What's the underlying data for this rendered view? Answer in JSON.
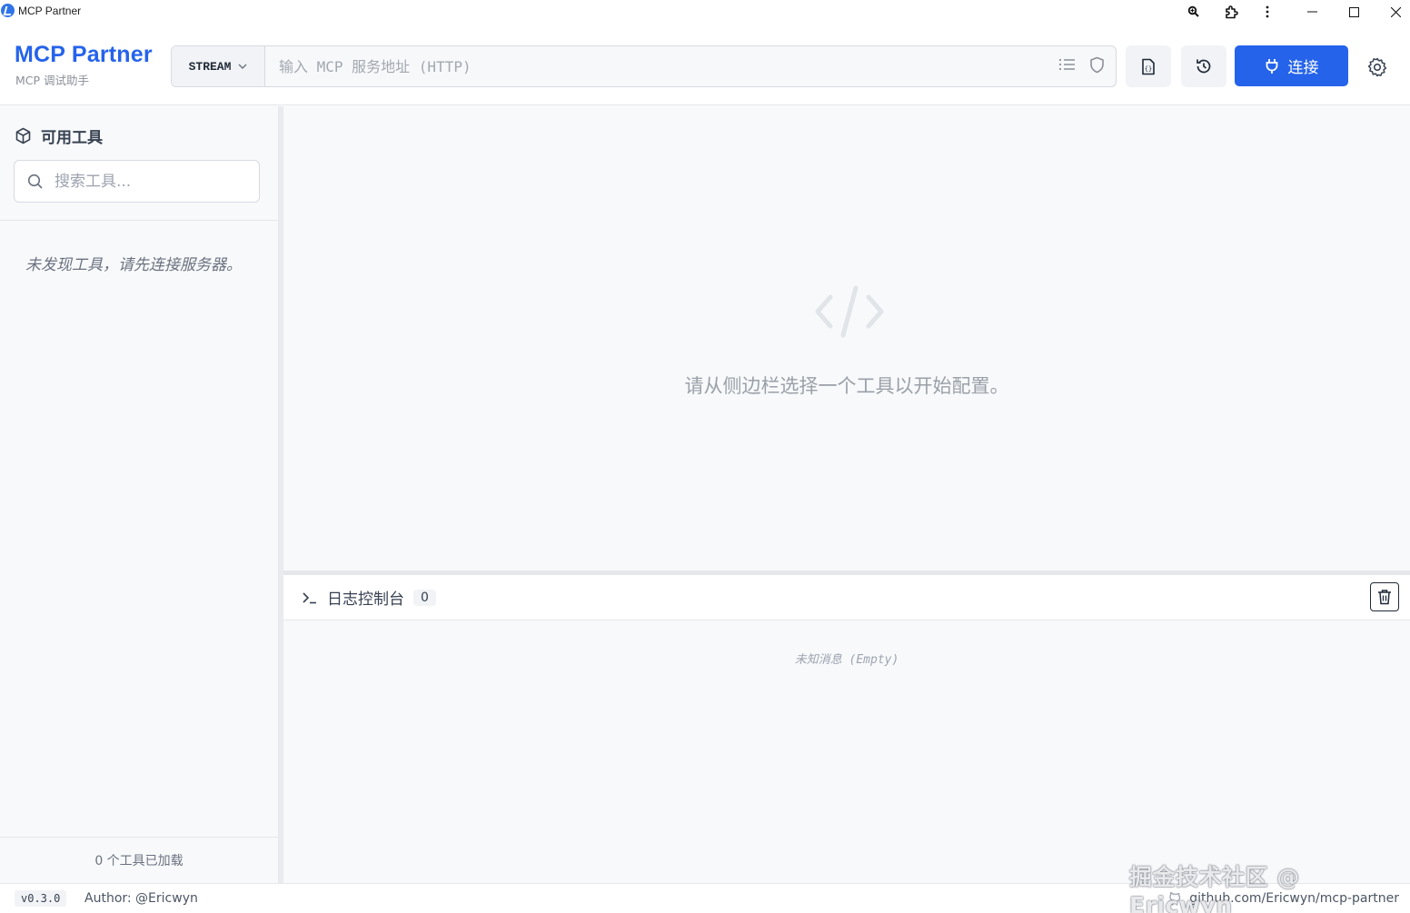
{
  "window": {
    "title": "MCP Partner",
    "controls": [
      "zoom-icon",
      "extension-icon",
      "more-vertical-icon",
      "minimize-icon",
      "maximize-icon",
      "close-icon"
    ]
  },
  "header": {
    "brand_title": "MCP Partner",
    "brand_subtitle": "MCP 调试助手",
    "transport_label": "STREAM",
    "url_placeholder": "输入 MCP 服务地址 (HTTP)",
    "url_value": "",
    "connect_label": "连接"
  },
  "sidebar": {
    "title": "可用工具",
    "search_placeholder": "搜索工具...",
    "empty_message": "未发现工具，请先连接服务器。",
    "footer": "0 个工具已加载"
  },
  "main": {
    "empty_message": "请从侧边栏选择一个工具以开始配置。"
  },
  "console": {
    "title": "日志控制台",
    "count": "0",
    "empty_message": "未知消息 (Empty)"
  },
  "status": {
    "version": "v0.3.0",
    "author": "Author: @Ericwyn",
    "repo": "github.com/Ericwyn/mcp-partner"
  },
  "watermark": "掘金技术社区 @ Ericwyn",
  "colors": {
    "accent": "#2563eb",
    "background": "#f8f9fb",
    "border": "#e5e7eb"
  }
}
